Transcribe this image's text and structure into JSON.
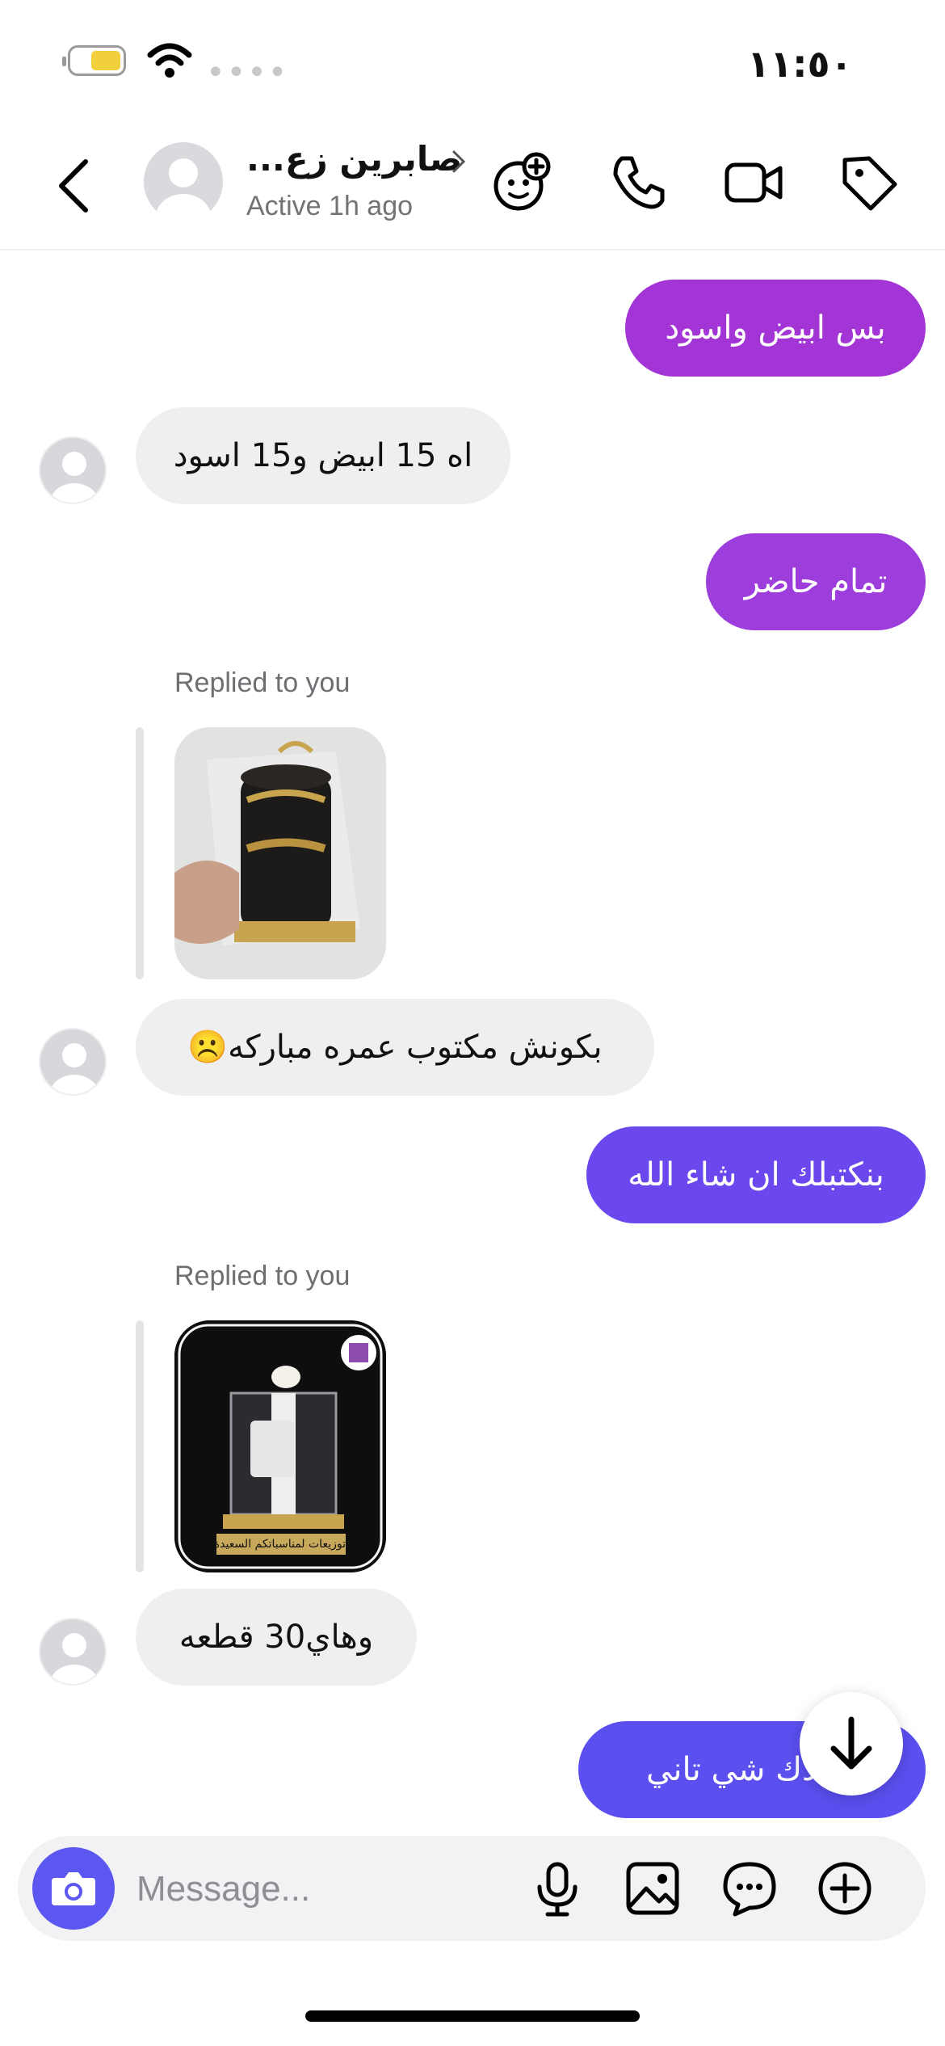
{
  "status_bar": {
    "time": "١١:٥٠",
    "signal_dots": "••••"
  },
  "header": {
    "contact_name": "صابرين زع...",
    "active_status": "Active 1h ago",
    "icons": [
      "back-arrow-icon",
      "chevron-right-icon",
      "add-effects-icon",
      "phone-icon",
      "video-icon",
      "tag-icon"
    ]
  },
  "messages": [
    {
      "side": "out",
      "text": "بس ابيض واسود",
      "color": "#a335d6"
    },
    {
      "side": "in",
      "text": "اه 15 ابيض و15 اسود"
    },
    {
      "side": "out",
      "text": "تمام حاضر",
      "color": "#9c3ddc"
    },
    {
      "side": "in",
      "reply_label": "Replied to you",
      "image": "gold-black-container-photo",
      "text": "بكونش مكتوب عمره مباركه☹️"
    },
    {
      "side": "out",
      "text": "بنكتبلك ان شاء الله",
      "color": "#6b48ee"
    },
    {
      "side": "in",
      "reply_label": "Replied to you",
      "image": "gift-box-product-photo",
      "image_caption": "توزيعات لمناسباتكم السعيدة",
      "text": "وهاي30 قطعه"
    },
    {
      "side": "out",
      "text": "بدك شي تاني",
      "color": "#5b4ff0"
    }
  ],
  "composer": {
    "placeholder": "Message...",
    "icons": [
      "camera-icon",
      "microphone-icon",
      "gallery-icon",
      "sticker-icon",
      "plus-icon"
    ]
  },
  "colors": {
    "accent": "#5b57f0",
    "incoming_bubble": "#efeff1"
  }
}
